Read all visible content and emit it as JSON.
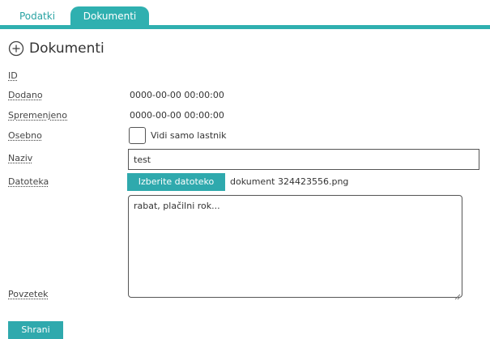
{
  "tabs": [
    {
      "label": "Podatki",
      "active": false
    },
    {
      "label": "Dokumenti",
      "active": true
    }
  ],
  "section": {
    "title": "Dokumenti",
    "icon": "plus-circle-icon"
  },
  "fields": {
    "id": {
      "label": "ID",
      "value": ""
    },
    "dodano": {
      "label": "Dodano",
      "value": "0000-00-00 00:00:00"
    },
    "spremenjeno": {
      "label": "Spremenjeno",
      "value": "0000-00-00 00:00:00"
    },
    "osebno": {
      "label": "Osebno",
      "checkbox_label": "Vidi samo lastnik",
      "checked": false
    },
    "naziv": {
      "label": "Naziv",
      "value": "test"
    },
    "datoteka": {
      "label": "Datoteka",
      "button_label": "Izberite datoteko",
      "file_name": "dokument 324423556.png"
    },
    "povzetek": {
      "label": "Povzetek",
      "value": "rabat, plačilni rok..."
    }
  },
  "actions": {
    "save_label": "Shrani"
  },
  "colors": {
    "accent": "#2fb0b0",
    "button": "#2fa9ad"
  }
}
